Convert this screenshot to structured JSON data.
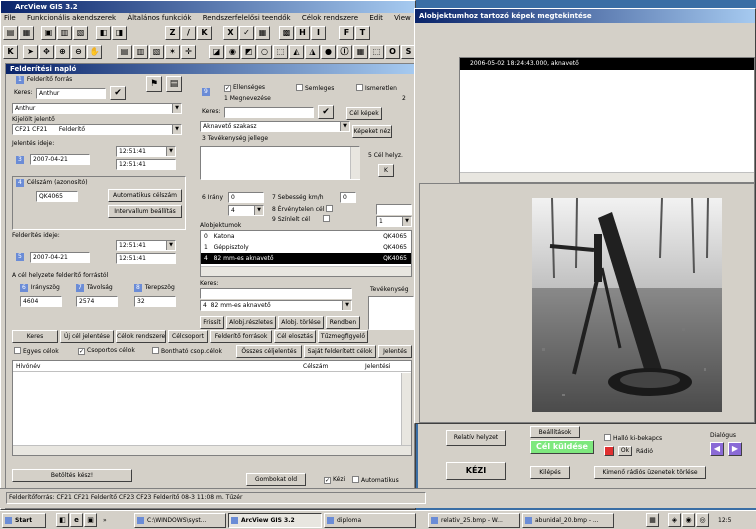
{
  "app": {
    "title": "ArcView GIS 3.2",
    "menu": [
      "File",
      "Funkcionális akendszerek",
      "Általános funkciók",
      "Rendszerfelelősi teendők",
      "Célok rendszere",
      "Edit",
      "View"
    ],
    "toolbar1": [
      "Z",
      "/",
      "K",
      "X",
      "✓",
      "H",
      "I",
      "F",
      "T"
    ],
    "toolbar2_first": "K"
  },
  "log": {
    "title": "Felderítési napló",
    "forras_label": "Felderítő forrás",
    "keres_label": "Keres:",
    "keres_value": "Anthur",
    "source_value": "Anthur",
    "egyseg_label": "Kijelölt jelentő",
    "egyseg_value": "CF21   CF21",
    "egyseg_type": "Felderítő",
    "jelentes_label": "Jelentés ideje:",
    "jelentes_num": "3",
    "jelentes_date": "2007-04-21",
    "time1": "12:51:41",
    "time2": "12:51:41",
    "celszam_num": "4",
    "celszam_label": "Célszám (azonosító)",
    "celszam_value": "QK4065",
    "auto_button": "Automatikus célszám",
    "interval_button": "Intervallum beállítás",
    "felderites_label": "Felderítés ideje:",
    "felderites_num": "5",
    "felderites_date": "2007-04-21",
    "time3": "12:51:41",
    "time4": "12:51:41",
    "helyzet_label": "A cél helyzete felderítő forrástól",
    "irany_num": "6",
    "irany_label": "Irányszög",
    "irany_value": "4604",
    "tav_num": "7",
    "tav_label": "Távolság",
    "tav_value": "2574",
    "terep_num": "8",
    "terep_label": "Terepszög",
    "terep_value": "32"
  },
  "mid": {
    "ellenseges": "Ellenséges",
    "semleges": "Semleges",
    "ismeretlen": "Ismeretlen",
    "megnevezes": "1  Megnevezése",
    "keres_label": "Keres:",
    "cel_kepek": "Cél képek",
    "aknaveto": "Aknavető szakasz",
    "kepeket_nez": "Képeket néz",
    "tevekenyseg": "3  Tevékenység jellege",
    "cel_helyzete": "5  Cél helyz.",
    "irany_label": "6  Irány",
    "irany_value": "0",
    "sebesseg_label": "7  Sebesség km/h",
    "sebesseg_value": "0",
    "ervenytelen": "8  Érvénytelen cél",
    "szinlelt": "9  Színlelt cél",
    "alobjektum_label": "Alobjektumok",
    "alobjektumok": [
      {
        "num": "0",
        "name": "Katona",
        "code": "QK4065",
        "selected": false
      },
      {
        "num": "1",
        "name": "Géppisztoly",
        "code": "QK4065",
        "selected": false
      },
      {
        "num": "4",
        "name": "82 mm-es aknavető",
        "code": "QK4065",
        "selected": true
      }
    ],
    "keres2_label": "Keres:",
    "sub_num": "4",
    "sub_value": "82 mm-es aknavető",
    "frissit": "Frissít",
    "alobj_reszletes": "Alobj.részletes",
    "alobj_torles": "Alobj. törlése",
    "rendben": "Rendben",
    "tevekenyseg2": "Tevékenység"
  },
  "bottom": {
    "tabs": [
      "Keres",
      "Új cél jelentése",
      "Célok rendszere",
      "Célcsoport",
      "Felderítő források",
      "Cél elosztás",
      "Tűzmegfigyelő"
    ],
    "egyes_celok": "Egyes célok",
    "csoportos_celok": "Csoportos célok",
    "bonthato": "Bontható csop.célok",
    "osszes": "Összes céljelentés",
    "sajat": "Saját felderített célok",
    "jelentes": "Jelentés",
    "col_hivonev": "Hívónév",
    "col_celszam": "Célszám",
    "col_jelentesi": "Jelentési",
    "betoltes": "Betöltés kész!",
    "gombokat": "Gombokat old",
    "kezi_cb": "Kézi",
    "automatikus": "Automatikus"
  },
  "status": {
    "text": "Felderítőforrás:  CF21  CF21          Felderítő      CF23  CF23          Felderítő      08-3   11:08 m.     Tűzér"
  },
  "image_viewer": {
    "title": "Alobjektumhoz tartozó képek megtekintése",
    "list_item": "2006-05-02 18:24:43.000,   aknavető"
  },
  "cmd": {
    "relativ": "Relatív helyzet",
    "beallitasok": "Beállítások",
    "cel_kuldese": "Cél küldése",
    "hallo": "Halló ki-bekapcs",
    "ok": "Ok",
    "radio": "Rádió",
    "dialogus": "Dialógus",
    "kezi": "KÉZI",
    "kilepes": "Kilépés",
    "kimeno": "Kimenő rádiós üzenetek törlése"
  },
  "taskbar": {
    "start": "Start",
    "items": [
      "C:\\WINDOWS\\syst...",
      "ArcView GIS 3.2",
      "diploma",
      "relativ_25.bmp - W...",
      "abunidal_20.bmp - ...",
      "12:5"
    ]
  }
}
